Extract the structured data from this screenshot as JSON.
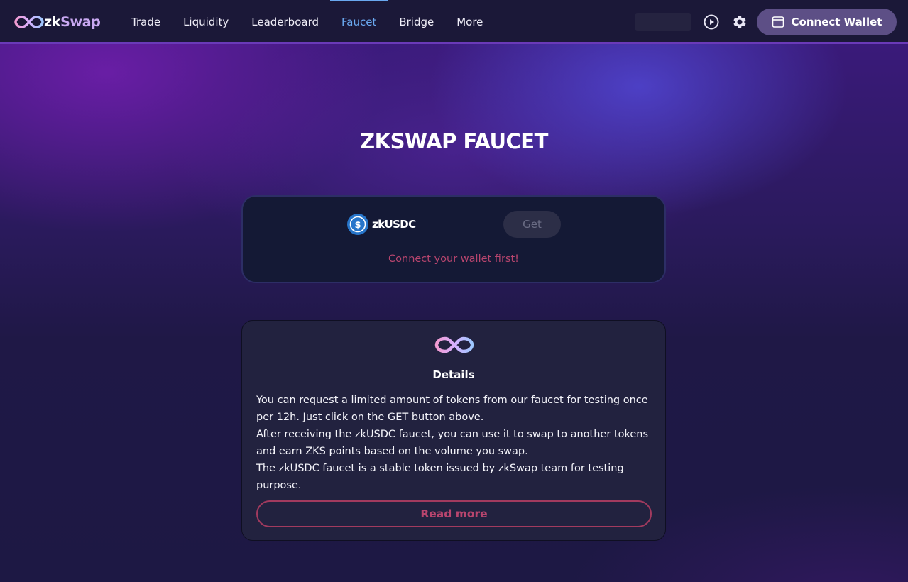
{
  "brand": {
    "prefix": "zk",
    "suffix": "Swap"
  },
  "nav": {
    "items": [
      {
        "label": "Trade"
      },
      {
        "label": "Liquidity"
      },
      {
        "label": "Leaderboard"
      },
      {
        "label": "Faucet",
        "active": true
      },
      {
        "label": "Bridge"
      },
      {
        "label": "More"
      }
    ]
  },
  "header": {
    "play_icon": "play-circle-icon",
    "settings_icon": "gear-icon",
    "connect_label": "Connect Wallet",
    "connect_icon": "wallet-icon"
  },
  "page": {
    "title": "ZKSWAP FAUCET"
  },
  "faucet": {
    "token": {
      "name": "zkUSDC",
      "icon": "usdc-icon"
    },
    "get_label": "Get",
    "warning": "Connect your wallet first!"
  },
  "details": {
    "title": "Details",
    "lines": [
      "You can request a limited amount of tokens from our faucet for testing once per 12h. Just click on the GET button above.",
      "After receiving the zkUSDC faucet, you can use it to swap to another tokens and earn ZKS points based on the volume you swap.",
      "The zkUSDC faucet is a stable token issued by zkSwap team for testing purpose."
    ],
    "read_more_label": "Read more"
  },
  "colors": {
    "accent_blue": "#6aa8f0",
    "warning_pink": "#b8456e",
    "connect_bg": "#5d4f86",
    "card_bg": "#141935"
  }
}
